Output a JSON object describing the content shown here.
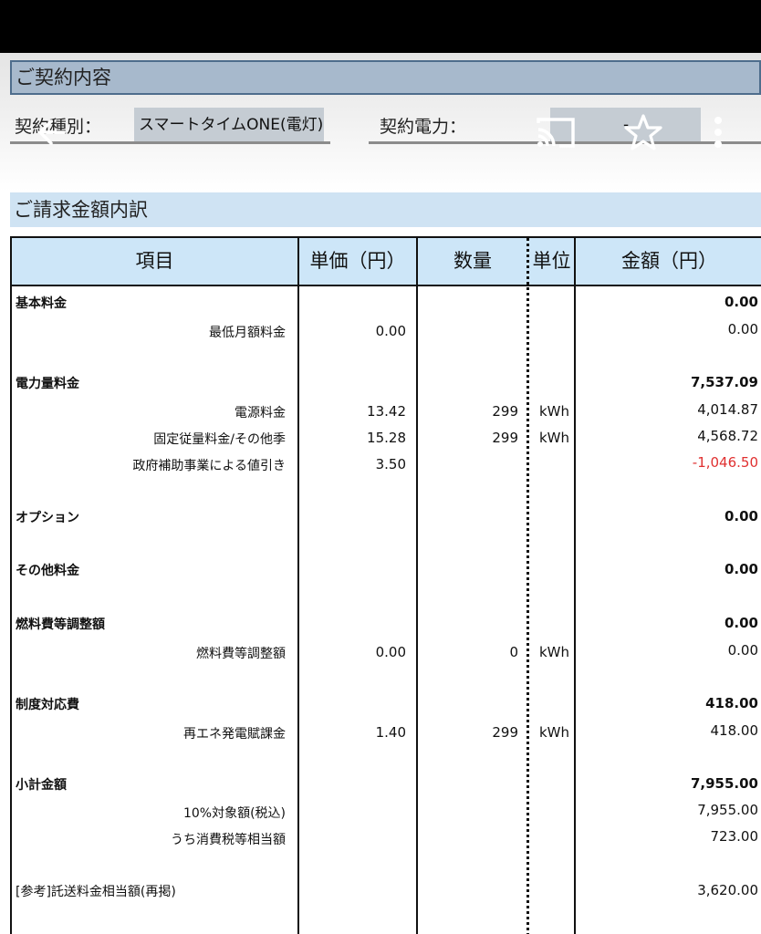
{
  "contract": {
    "title": "ご契約内容",
    "type_label": "契約種別：",
    "type_value": "スマートタイムONE(電灯)",
    "power_label": "契約電力：",
    "power_value": "-"
  },
  "billing": {
    "title": "ご請求金額内訳",
    "headers": {
      "item": "項目",
      "unit_price": "単価（円）",
      "quantity": "数量",
      "unit": "単位",
      "amount": "金額（円）"
    },
    "rows": {
      "kihon": {
        "label": "基本料金",
        "amount": "0.00"
      },
      "saitei": {
        "label": "最低月額料金",
        "price": "0.00",
        "amount": "0.00"
      },
      "denryoku": {
        "label": "電力量料金",
        "amount": "7,537.09"
      },
      "dengen": {
        "label": "電源料金",
        "price": "13.42",
        "qty": "299",
        "unit": "kWh",
        "amount": "4,014.87"
      },
      "koteijuryo": {
        "label": "固定従量料金/その他季",
        "price": "15.28",
        "qty": "299",
        "unit": "kWh",
        "amount": "4,568.72"
      },
      "hojo": {
        "label": "政府補助事業による値引き",
        "price": "3.50",
        "amount": "-1,046.50"
      },
      "option": {
        "label": "オプション",
        "amount": "0.00"
      },
      "sonota": {
        "label": "その他料金",
        "amount": "0.00"
      },
      "nenryo_cat": {
        "label": "燃料費等調整額",
        "amount": "0.00"
      },
      "nenryo": {
        "label": "燃料費等調整額",
        "price": "0.00",
        "qty": "0",
        "unit": "kWh",
        "amount": "0.00"
      },
      "seido": {
        "label": "制度対応費",
        "amount": "418.00"
      },
      "saiene": {
        "label": "再エネ発電賦課金",
        "price": "1.40",
        "qty": "299",
        "unit": "kWh",
        "amount": "418.00"
      },
      "shokei": {
        "label": "小計金額",
        "amount": "7,955.00"
      },
      "taisho10": {
        "label": "10%対象額(税込)",
        "amount": "7,955.00"
      },
      "shohizei": {
        "label": "うち消費税等相当額",
        "amount": "723.00"
      },
      "takuso": {
        "label": "[参考]託送料金相当額(再掲)",
        "amount": "3,620.00"
      }
    }
  }
}
